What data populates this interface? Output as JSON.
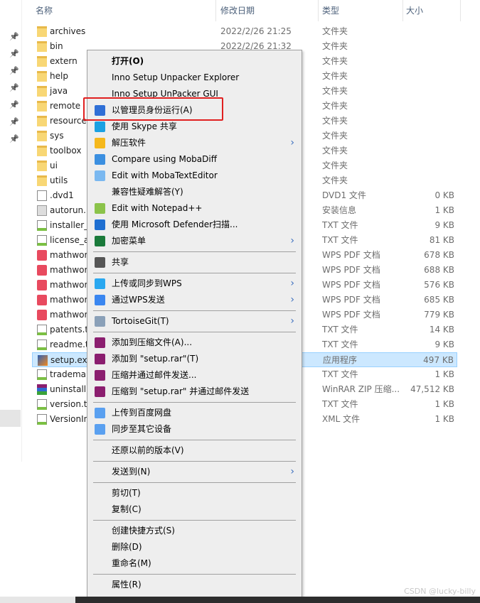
{
  "columns": {
    "name": "名称",
    "date": "修改日期",
    "type": "类型",
    "size": "大小"
  },
  "files": [
    {
      "name": "archives",
      "date": "2022/2/26 21:25",
      "type": "文件夹",
      "size": "",
      "icon": "folder"
    },
    {
      "name": "bin",
      "date": "2022/2/26 21:32",
      "type": "文件夹",
      "size": "",
      "icon": "folder"
    },
    {
      "name": "extern",
      "date": "",
      "type": "文件夹",
      "size": "",
      "icon": "folder"
    },
    {
      "name": "help",
      "date": "",
      "type": "文件夹",
      "size": "",
      "icon": "folder"
    },
    {
      "name": "java",
      "date": "",
      "type": "文件夹",
      "size": "",
      "icon": "folder"
    },
    {
      "name": "remote",
      "date": "",
      "type": "文件夹",
      "size": "",
      "icon": "folder"
    },
    {
      "name": "resource",
      "date": "",
      "type": "文件夹",
      "size": "",
      "icon": "folder"
    },
    {
      "name": "sys",
      "date": "",
      "type": "文件夹",
      "size": "",
      "icon": "folder"
    },
    {
      "name": "toolbox",
      "date": "",
      "type": "文件夹",
      "size": "",
      "icon": "folder"
    },
    {
      "name": "ui",
      "date": "",
      "type": "文件夹",
      "size": "",
      "icon": "folder"
    },
    {
      "name": "utils",
      "date": "",
      "type": "文件夹",
      "size": "",
      "icon": "folder"
    },
    {
      "name": ".dvd1",
      "date": "",
      "type": "DVD1 文件",
      "size": "0 KB",
      "icon": "file"
    },
    {
      "name": "autorun.i",
      "date": "",
      "type": "安装信息",
      "size": "1 KB",
      "icon": "ini"
    },
    {
      "name": "installer_i",
      "date": "",
      "type": "TXT 文件",
      "size": "9 KB",
      "icon": "txt"
    },
    {
      "name": "license_a",
      "date": "",
      "type": "TXT 文件",
      "size": "81 KB",
      "icon": "txt"
    },
    {
      "name": "mathwor",
      "date": "",
      "type": "WPS PDF 文档",
      "size": "678 KB",
      "icon": "pdf"
    },
    {
      "name": "mathwor",
      "date": "",
      "type": "WPS PDF 文档",
      "size": "688 KB",
      "icon": "pdf"
    },
    {
      "name": "mathwor",
      "date": "",
      "type": "WPS PDF 文档",
      "size": "576 KB",
      "icon": "pdf"
    },
    {
      "name": "mathwor",
      "date": "",
      "type": "WPS PDF 文档",
      "size": "685 KB",
      "icon": "pdf"
    },
    {
      "name": "mathwor",
      "date": "",
      "type": "WPS PDF 文档",
      "size": "779 KB",
      "icon": "pdf"
    },
    {
      "name": "patents.t",
      "date": "",
      "type": "TXT 文件",
      "size": "14 KB",
      "icon": "txt"
    },
    {
      "name": "readme.t",
      "date": "",
      "type": "TXT 文件",
      "size": "9 KB",
      "icon": "txt"
    },
    {
      "name": "setup.exe",
      "date": "",
      "type": "应用程序",
      "size": "497 KB",
      "icon": "exe",
      "selected": true
    },
    {
      "name": "tradema",
      "date": "",
      "type": "TXT 文件",
      "size": "1 KB",
      "icon": "txt"
    },
    {
      "name": "uninstall.",
      "date": "",
      "type": "WinRAR ZIP 压缩...",
      "size": "47,512 KB",
      "icon": "rar"
    },
    {
      "name": "version.t",
      "date": "",
      "type": "TXT 文件",
      "size": "1 KB",
      "icon": "txt"
    },
    {
      "name": "VersionIn",
      "date": "",
      "type": "XML 文件",
      "size": "1 KB",
      "icon": "txt"
    }
  ],
  "context_menu": [
    {
      "label": "打开(O)",
      "bold": true
    },
    {
      "label": "Inno Setup Unpacker Explorer"
    },
    {
      "label": "Inno Setup UnPacker GUI"
    },
    {
      "label": "以管理员身份运行(A)",
      "icon": "shield",
      "color": "#2f6fd6"
    },
    {
      "label": "使用 Skype 共享",
      "icon": "skype",
      "color": "#1ba1e2"
    },
    {
      "label": "解压软件",
      "icon": "zip",
      "color": "#f5b81c",
      "submenu": true
    },
    {
      "label": "Compare using MobaDiff",
      "icon": "mobadiff",
      "color": "#3b8fe0"
    },
    {
      "label": "Edit with MobaTextEditor",
      "icon": "mobatext",
      "color": "#7ab8f0"
    },
    {
      "label": "兼容性疑难解答(Y)"
    },
    {
      "label": "Edit with Notepad++",
      "icon": "notepad",
      "color": "#8bc34a"
    },
    {
      "label": "使用 Microsoft Defender扫描...",
      "icon": "defender",
      "color": "#1f6fd1"
    },
    {
      "label": "加密菜单",
      "icon": "encrypt",
      "color": "#1a7a3a",
      "submenu": true
    },
    {
      "separator": true
    },
    {
      "label": "共享",
      "icon": "share",
      "color": "#555555"
    },
    {
      "separator": true
    },
    {
      "label": "上传或同步到WPS",
      "icon": "wps-cloud",
      "color": "#2aa8f0",
      "submenu": true
    },
    {
      "label": "通过WPS发送",
      "icon": "wps-send",
      "color": "#3a86f0",
      "submenu": true
    },
    {
      "separator": true
    },
    {
      "label": "TortoiseGit(T)",
      "icon": "tortoisegit",
      "color": "#8aa0b8",
      "submenu": true
    },
    {
      "separator": true
    },
    {
      "label": "添加到压缩文件(A)...",
      "icon": "winrar",
      "color": "#8b1e6f"
    },
    {
      "label": "添加到 \"setup.rar\"(T)",
      "icon": "winrar",
      "color": "#8b1e6f"
    },
    {
      "label": "压缩并通过邮件发送...",
      "icon": "winrar",
      "color": "#8b1e6f"
    },
    {
      "label": "压缩到 \"setup.rar\" 并通过邮件发送",
      "icon": "winrar",
      "color": "#8b1e6f"
    },
    {
      "separator": true
    },
    {
      "label": "上传到百度网盘",
      "icon": "baidu",
      "color": "#5aa0f0"
    },
    {
      "label": "同步至其它设备",
      "icon": "baidu",
      "color": "#5aa0f0"
    },
    {
      "separator": true
    },
    {
      "label": "还原以前的版本(V)"
    },
    {
      "separator": true
    },
    {
      "label": "发送到(N)",
      "submenu": true
    },
    {
      "separator": true
    },
    {
      "label": "剪切(T)"
    },
    {
      "label": "复制(C)"
    },
    {
      "separator": true
    },
    {
      "label": "创建快捷方式(S)"
    },
    {
      "label": "删除(D)"
    },
    {
      "label": "重命名(M)"
    },
    {
      "separator": true
    },
    {
      "label": "属性(R)"
    }
  ],
  "watermark": "CSDN @lucky-billy",
  "highlight_color": "#e02020"
}
